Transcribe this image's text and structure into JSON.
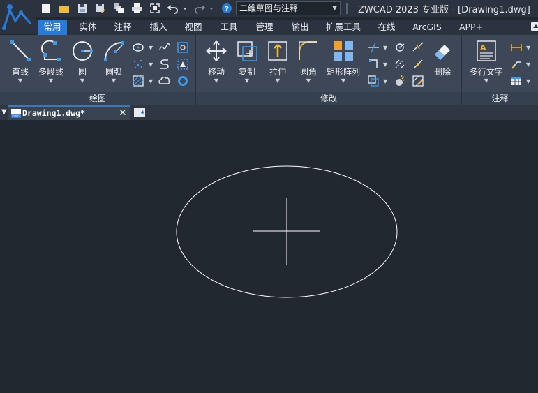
{
  "title_bar": {
    "title": "ZWCAD 2023 专业版 - [Drawing1.dwg]",
    "workspace": "二维草图与注释"
  },
  "quick_access": [
    "new-icon",
    "open-icon",
    "save-icon",
    "save-as-icon",
    "batch-icon",
    "print-icon",
    "fullscreen-icon",
    "undo-icon",
    "redo-icon",
    "help-icon"
  ],
  "menu_tabs": [
    "常用",
    "实体",
    "注释",
    "插入",
    "视图",
    "工具",
    "管理",
    "输出",
    "扩展工具",
    "在线",
    "ArcGIS",
    "APP+"
  ],
  "active_tab": "常用",
  "ribbon": {
    "draw": {
      "title": "绘图",
      "line": "直线",
      "polyline": "多段线",
      "circle": "圆",
      "arc": "圆弧"
    },
    "modify": {
      "title": "修改",
      "move": "移动",
      "copy": "复制",
      "stretch": "拉伸",
      "fillet": "圆角",
      "array": "矩形阵列",
      "erase": "删除"
    },
    "annotate": {
      "title": "注释",
      "mtext": "多行文字"
    }
  },
  "document_tabs": {
    "active": "Drawing1.dwg*"
  },
  "colors": {
    "accent": "#2a7bd6",
    "canvas": "#212830",
    "ribbon": "#3d4757",
    "geometry": "#ffffff"
  }
}
